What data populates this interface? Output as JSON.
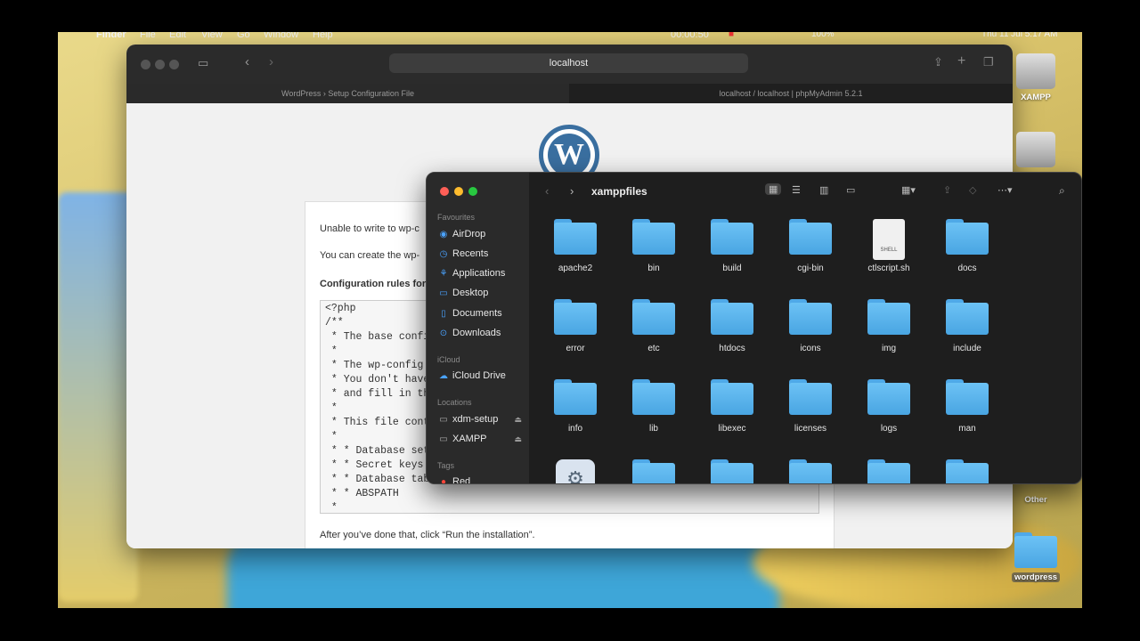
{
  "menubar": {
    "app_name": "Finder",
    "menus": [
      "File",
      "Edit",
      "View",
      "Go",
      "Window",
      "Help"
    ],
    "timer": "00:00:50",
    "battery": "100%",
    "datetime": "Thu 11 Jul  5:17 AM"
  },
  "safari": {
    "url": "localhost",
    "tabs": [
      {
        "title": "WordPress › Setup Configuration File",
        "active": true
      },
      {
        "title": "localhost / localhost | phpMyAdmin 5.2.1",
        "active": false
      }
    ],
    "wp_logo_letter": "W",
    "lines": [
      "Unable to write to wp-c",
      "You can create the wp-",
      "Configuration rules for",
      "After you’ve done that, click “Run the installation”."
    ],
    "config_code": "<?php\n/**\n * The base confi\n *\n * The wp-config.\n * You don't have\n * and fill in th\n *\n * This file cont\n *\n * * Database set\n * * Secret keys\n * * Database tab\n * * ABSPATH\n *"
  },
  "desktop": {
    "icons": [
      {
        "label": "XAMPP"
      },
      {
        "label": "Other"
      },
      {
        "label": "wordpress"
      }
    ]
  },
  "finder": {
    "title": "xamppfiles",
    "sidebar": {
      "favourites_header": "Favourites",
      "favourites": [
        {
          "label": "AirDrop",
          "icon": "airdrop-icon"
        },
        {
          "label": "Recents",
          "icon": "clock-icon"
        },
        {
          "label": "Applications",
          "icon": "applications-icon"
        },
        {
          "label": "Desktop",
          "icon": "desktop-icon"
        },
        {
          "label": "Documents",
          "icon": "document-icon"
        },
        {
          "label": "Downloads",
          "icon": "download-icon"
        }
      ],
      "icloud_header": "iCloud",
      "icloud": [
        {
          "label": "iCloud Drive",
          "icon": "cloud-icon"
        }
      ],
      "locations_header": "Locations",
      "locations": [
        {
          "label": "xdm-setup",
          "icon": "drive-icon"
        },
        {
          "label": "XAMPP",
          "icon": "drive-icon"
        }
      ],
      "tags_header": "Tags",
      "tags": [
        {
          "label": "Red",
          "color": "#ff453a"
        }
      ]
    },
    "items": [
      {
        "name": "apache2",
        "type": "folder"
      },
      {
        "name": "bin",
        "type": "folder"
      },
      {
        "name": "build",
        "type": "folder"
      },
      {
        "name": "cgi-bin",
        "type": "folder"
      },
      {
        "name": "ctlscript.sh",
        "type": "shell",
        "badge": "SHELL"
      },
      {
        "name": "docs",
        "type": "folder"
      },
      {
        "name": "error",
        "type": "folder"
      },
      {
        "name": "etc",
        "type": "folder"
      },
      {
        "name": "htdocs",
        "type": "folder"
      },
      {
        "name": "icons",
        "type": "folder"
      },
      {
        "name": "img",
        "type": "folder"
      },
      {
        "name": "include",
        "type": "folder"
      },
      {
        "name": "info",
        "type": "folder"
      },
      {
        "name": "lib",
        "type": "folder"
      },
      {
        "name": "libexec",
        "type": "folder"
      },
      {
        "name": "licenses",
        "type": "folder"
      },
      {
        "name": "logs",
        "type": "folder"
      },
      {
        "name": "man",
        "type": "folder"
      }
    ]
  }
}
